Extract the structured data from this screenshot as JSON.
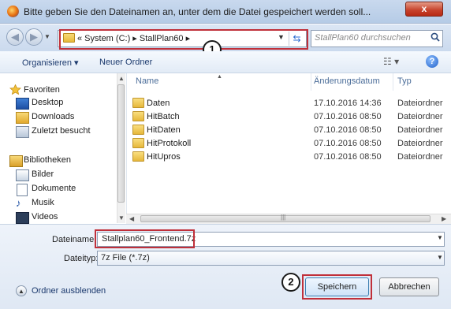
{
  "window": {
    "title": "Bitte geben Sie den Dateinamen an, unter dem die Datei gespeichert werden soll...",
    "close_label": "x"
  },
  "nav": {
    "breadcrumb": "« System (C:) ▸ StallPlan60 ▸",
    "search_placeholder": "StallPlan60 durchsuchen"
  },
  "toolbar": {
    "organize_label": "Organisieren ▾",
    "new_folder_label": "Neuer Ordner",
    "view_label": "☷ ▾",
    "help_label": "?"
  },
  "nav_pane": {
    "favorites_label": "Favoriten",
    "favorites": [
      "Desktop",
      "Downloads",
      "Zuletzt besucht"
    ],
    "libraries_label": "Bibliotheken",
    "libraries": [
      "Bilder",
      "Dokumente",
      "Musik",
      "Videos"
    ]
  },
  "file_list": {
    "columns": [
      "Name",
      "Änderungsdatum",
      "Typ"
    ],
    "rows": [
      {
        "name": "Daten",
        "date": "17.10.2016 14:36",
        "type": "Dateiordner"
      },
      {
        "name": "HitBatch",
        "date": "07.10.2016 08:50",
        "type": "Dateiordner"
      },
      {
        "name": "HitDaten",
        "date": "07.10.2016 08:50",
        "type": "Dateiordner"
      },
      {
        "name": "HitProtokoll",
        "date": "07.10.2016 08:50",
        "type": "Dateiordner"
      },
      {
        "name": "HitUpros",
        "date": "07.10.2016 08:50",
        "type": "Dateiordner"
      }
    ]
  },
  "form": {
    "filename_label": "Dateiname:",
    "filename_value": "Stallplan60_Frontend.7z",
    "filetype_label": "Dateityp:",
    "filetype_value": "7z File (*.7z)"
  },
  "footer": {
    "hide_folders_label": "Ordner ausblenden",
    "save_label": "Speichern",
    "cancel_label": "Abbrechen"
  },
  "annotations": {
    "badge1": "1",
    "badge2": "2"
  },
  "colors": {
    "highlight": "#c0303a",
    "title_bar": "#c9d9ee",
    "close_button": "#c6402a"
  }
}
